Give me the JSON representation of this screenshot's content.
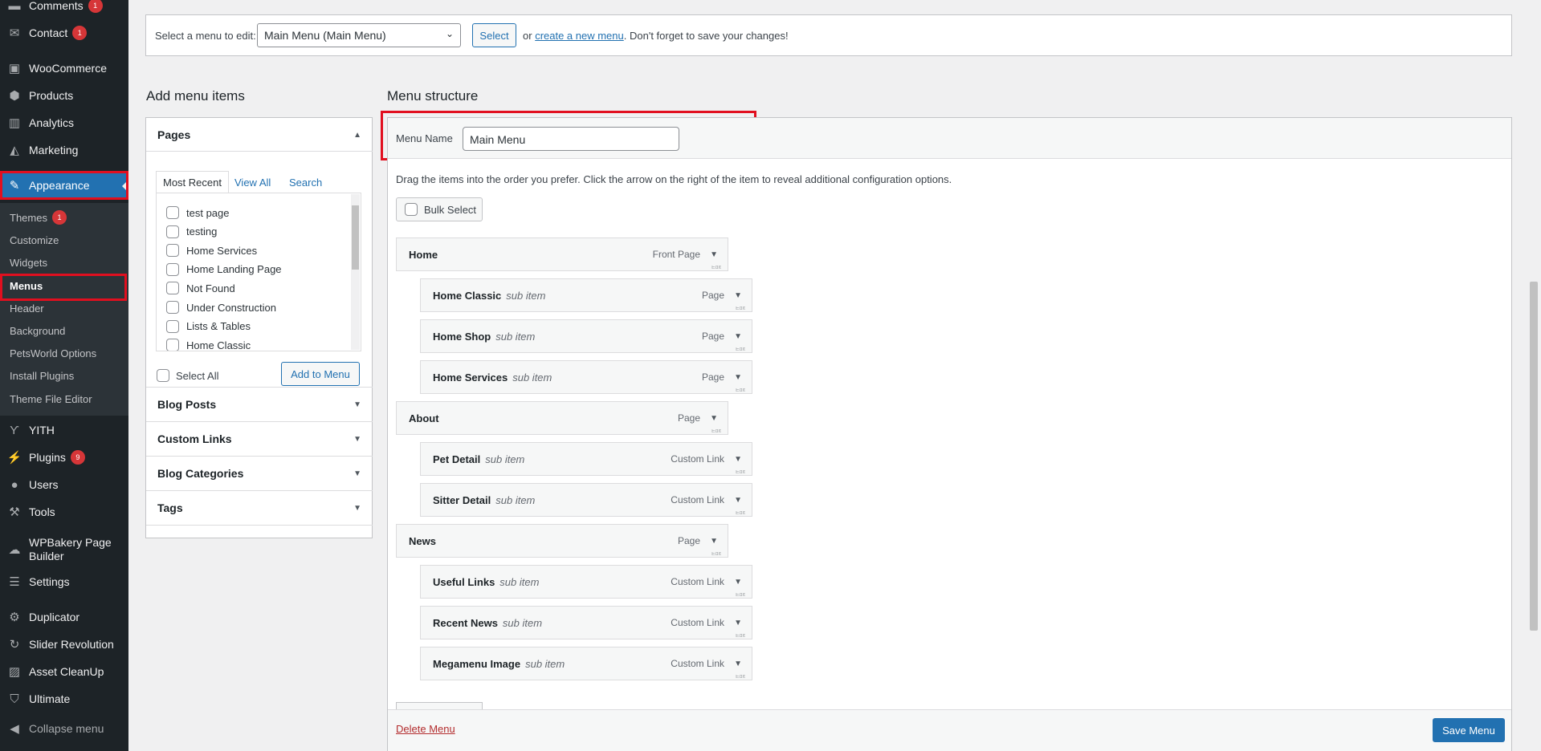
{
  "sidebar": {
    "items": [
      {
        "label": "Comments",
        "badge": "1",
        "icon": "comment-icon"
      },
      {
        "label": "Contact",
        "badge": "1",
        "icon": "mail-icon"
      },
      {
        "label": "WooCommerce",
        "badge": "",
        "icon": "woo-icon"
      },
      {
        "label": "Products",
        "badge": "",
        "icon": "box-icon"
      },
      {
        "label": "Analytics",
        "badge": "",
        "icon": "bar-chart-icon"
      },
      {
        "label": "Marketing",
        "badge": "",
        "icon": "megaphone-icon"
      },
      {
        "label": "Appearance",
        "badge": "",
        "icon": "brush-icon"
      },
      {
        "label": "YITH",
        "badge": "",
        "icon": "yith-icon"
      },
      {
        "label": "Plugins",
        "badge": "9",
        "icon": "plug-icon"
      },
      {
        "label": "Users",
        "badge": "",
        "icon": "user-icon"
      },
      {
        "label": "Tools",
        "badge": "",
        "icon": "wrench-icon"
      },
      {
        "label": "WPBakery Page Builder",
        "badge": "",
        "icon": "cloud-icon"
      },
      {
        "label": "Settings",
        "badge": "",
        "icon": "sliders-icon"
      },
      {
        "label": "Duplicator",
        "badge": "",
        "icon": "gear-icon"
      },
      {
        "label": "Slider Revolution",
        "badge": "",
        "icon": "refresh-icon"
      },
      {
        "label": "Asset CleanUp",
        "badge": "",
        "icon": "image-icon"
      },
      {
        "label": "Ultimate",
        "badge": "",
        "icon": "shield-icon"
      }
    ],
    "submenu": [
      {
        "label": "Themes",
        "badge": "1"
      },
      {
        "label": "Customize"
      },
      {
        "label": "Widgets"
      },
      {
        "label": "Menus"
      },
      {
        "label": "Header"
      },
      {
        "label": "Background"
      },
      {
        "label": "PetsWorld Options"
      },
      {
        "label": "Install Plugins"
      },
      {
        "label": "Theme File Editor"
      }
    ],
    "collapse_label": "Collapse menu"
  },
  "topbar": {
    "select_label": "Select a menu to edit:",
    "selected_menu": "Main Menu (Main Menu)",
    "select_button": "Select",
    "or_text": "or",
    "create_link": "create a new menu",
    "save_note": ". Don't forget to save your changes!"
  },
  "add_items": {
    "heading": "Add menu items",
    "pages_title": "Pages",
    "tabs": [
      "Most Recent",
      "View All",
      "Search"
    ],
    "pages": [
      "test page",
      "testing",
      "Home Services",
      "Home Landing Page",
      "Not Found",
      "Under Construction",
      "Lists & Tables",
      "Home Classic"
    ],
    "select_all": "Select All",
    "add_button": "Add to Menu",
    "sections": [
      "Blog Posts",
      "Custom Links",
      "Blog Categories",
      "Tags"
    ]
  },
  "structure": {
    "heading": "Menu structure",
    "name_label": "Menu Name",
    "name_value": "Main Menu",
    "instructions": "Drag the items into the order you prefer. Click the arrow on the right of the item to reveal additional configuration options.",
    "bulk_select": "Bulk Select",
    "sub_label": "sub item",
    "items": [
      {
        "title": "Home",
        "type": "Front Page",
        "depth": 0
      },
      {
        "title": "Home Classic",
        "type": "Page",
        "depth": 1
      },
      {
        "title": "Home Shop",
        "type": "Page",
        "depth": 1
      },
      {
        "title": "Home Services",
        "type": "Page",
        "depth": 1
      },
      {
        "title": "About",
        "type": "Page",
        "depth": 0
      },
      {
        "title": "Pet Detail",
        "type": "Custom Link",
        "depth": 1
      },
      {
        "title": "Sitter Detail",
        "type": "Custom Link",
        "depth": 1
      },
      {
        "title": "News",
        "type": "Page",
        "depth": 0
      },
      {
        "title": "Useful Links",
        "type": "Custom Link",
        "depth": 1
      },
      {
        "title": "Recent News",
        "type": "Custom Link",
        "depth": 1
      },
      {
        "title": "Megamenu Image",
        "type": "Custom Link",
        "depth": 1
      }
    ],
    "edit_text": "Edit",
    "delete_link": "Delete Menu",
    "save_button": "Save Menu"
  }
}
